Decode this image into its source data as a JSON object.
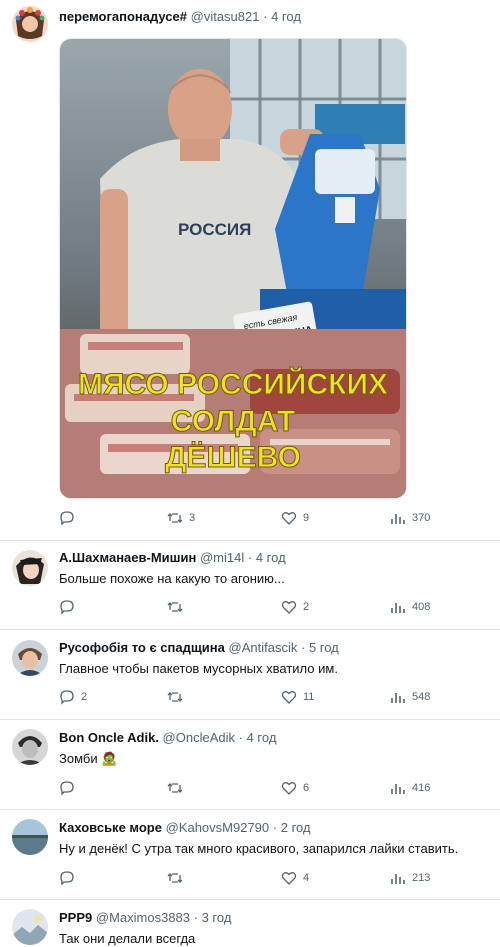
{
  "tweets": [
    {
      "name": "перемогапонадусе#",
      "handle": "@vitasu821",
      "time": "4 год",
      "text": "",
      "image_text": {
        "shirt": "РОССИЯ",
        "sign_line1": "есть свежая",
        "sign_line2": "ЧЕЛОВЕЧИНА",
        "caption_line1": "МЯСО РОССИЙСКИХ",
        "caption_line2": "СОЛДАТ",
        "caption_line3": "ДЁШЕВО"
      },
      "replies": "",
      "retweets": "3",
      "likes": "9",
      "views": "370"
    },
    {
      "name": "А.Шахманаев-Мишин",
      "handle": "@mi14l",
      "time": "4 год",
      "text": "Больше похоже на какую то агонию...",
      "replies": "",
      "retweets": "",
      "likes": "2",
      "views": "408"
    },
    {
      "name": "Русофобія то є спадщина",
      "handle": "@Antifascik",
      "time": "5 год",
      "text": "Главное чтобы пакетов мусорных хватило им.",
      "replies": "2",
      "retweets": "",
      "likes": "11",
      "views": "548"
    },
    {
      "name": "Bon Oncle Adik.",
      "handle": "@OncleAdik",
      "time": "4 год",
      "text": "Зомби 🧟",
      "replies": "",
      "retweets": "",
      "likes": "6",
      "views": "416"
    },
    {
      "name": "Каховське море",
      "handle": "@KahovsM92790",
      "time": "2 год",
      "text": "Ну и денёк! С утра так много красивого, запарился лайки ставить.",
      "replies": "",
      "retweets": "",
      "likes": "4",
      "views": "213"
    },
    {
      "name": "PPP9",
      "handle": "@Maximos3883",
      "time": "3 год",
      "text": "Так они делали всегда"
    }
  ],
  "separator": "·",
  "colors": {
    "text": "#0f1419",
    "secondary": "#536471",
    "border": "#e1e6ea",
    "caption": "#f2e21a"
  },
  "icons": [
    "reply-icon",
    "retweet-icon",
    "like-icon",
    "views-icon"
  ]
}
